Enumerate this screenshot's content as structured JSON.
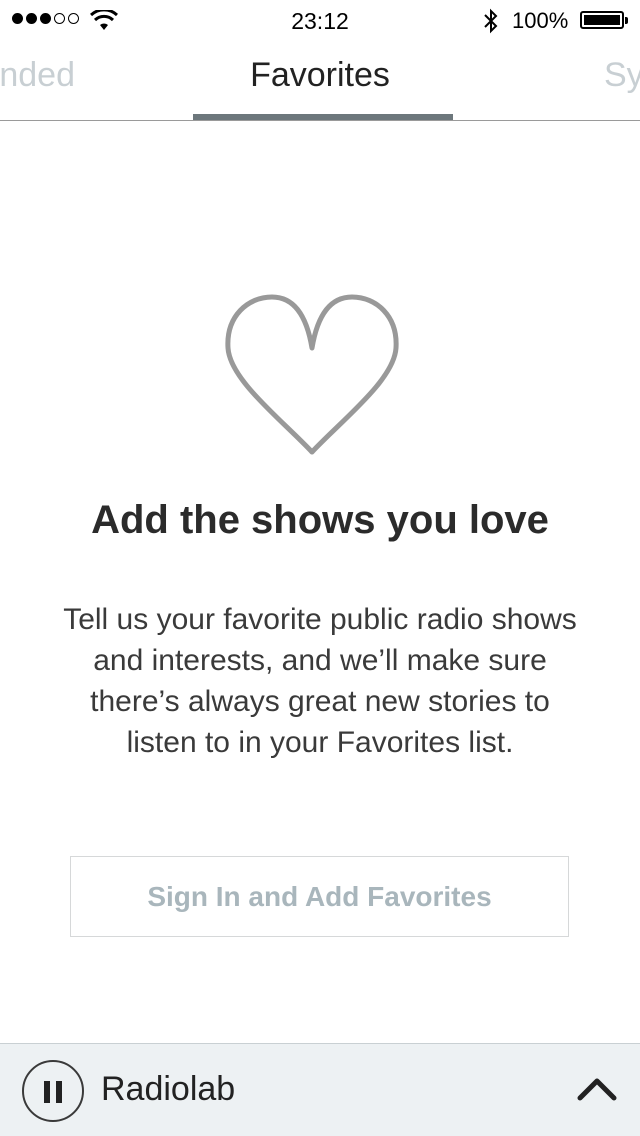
{
  "status_bar": {
    "time": "23:12",
    "battery_percent": "100%",
    "signal_bars_filled": 3,
    "signal_bars_total": 5
  },
  "tabs": [
    {
      "label": "nded",
      "active": false
    },
    {
      "label": "Favorites",
      "active": true
    },
    {
      "label": "Sy",
      "active": false
    }
  ],
  "main": {
    "icon": "heart-outline-icon",
    "title": "Add the shows you love",
    "description": "Tell us your favorite public radio shows and interests, and we’ll make sure there’s always great new stories to listen to in your Favorites list.",
    "button_label": "Sign In and Add Favorites"
  },
  "player": {
    "show_name": "Radiolab",
    "state": "playing",
    "icons": [
      "pause-icon",
      "chevron-up-icon"
    ]
  },
  "colors": {
    "accent_indicator": "#6d777c",
    "inactive_tab": "#c8cfd3",
    "button_text": "#a9b6bc",
    "player_bg": "#edf1f3",
    "heart_stroke": "#999999"
  }
}
